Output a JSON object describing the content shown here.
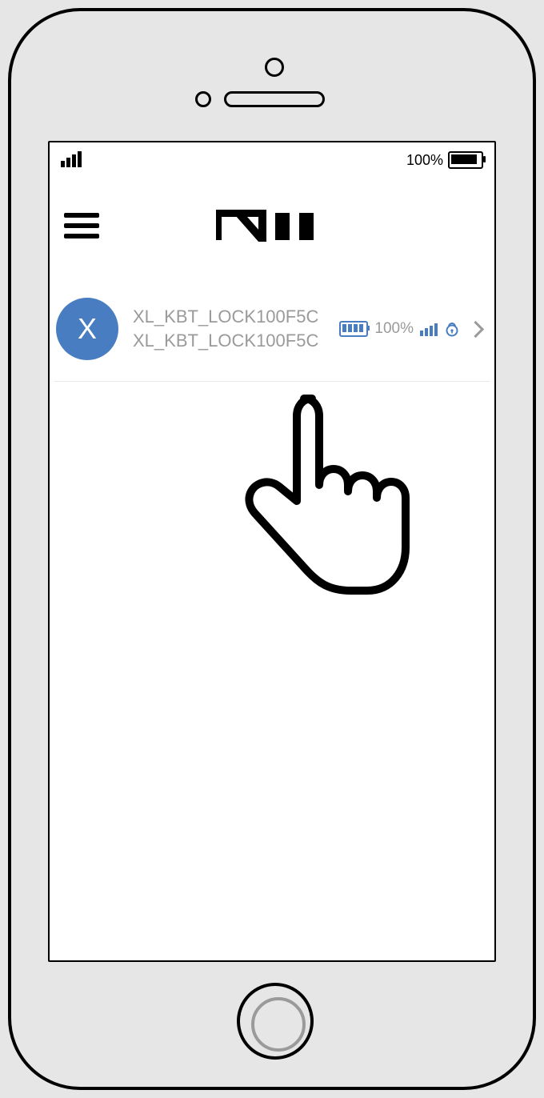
{
  "status": {
    "battery_label": "100%"
  },
  "device_row": {
    "avatar_letter": "X",
    "title": "XL_KBT_LOCK100F5C",
    "subtitle": "XL_KBT_LOCK100F5C",
    "battery_percent": "100%"
  },
  "colors": {
    "accent": "#497dc1"
  }
}
